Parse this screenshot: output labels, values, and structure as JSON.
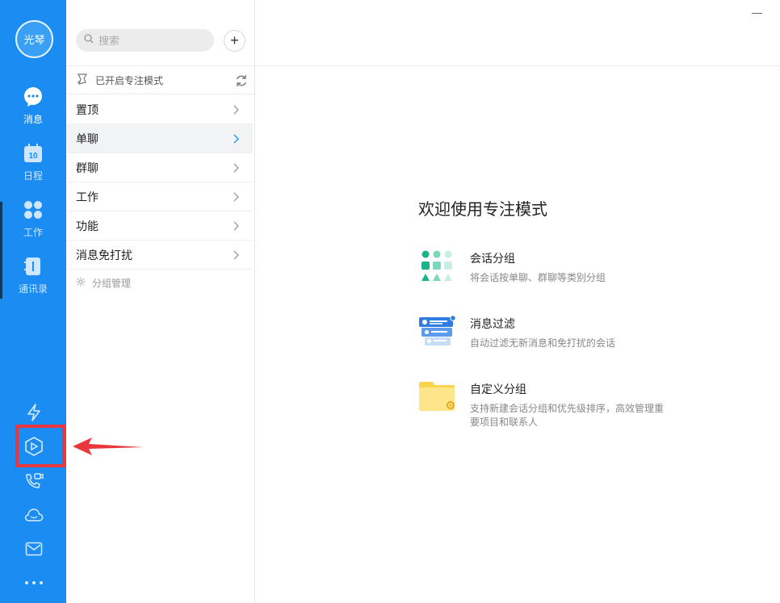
{
  "rail": {
    "avatar_text": "光琴",
    "nav": [
      {
        "label": "消息",
        "icon": "chat-icon",
        "active": true
      },
      {
        "label": "日程",
        "icon": "calendar-icon",
        "badge": "10"
      },
      {
        "label": "工作",
        "icon": "apps-grid-icon"
      },
      {
        "label": "通讯录",
        "icon": "contacts-book-icon"
      }
    ],
    "utilities": [
      "lightning-icon",
      "hexagon-app-icon",
      "phone-video-icon",
      "cloud-icon",
      "mail-icon",
      "more-dots-icon"
    ]
  },
  "middle": {
    "search_placeholder": "搜索",
    "add_label": "+",
    "focus_mode_label": "已开启专注模式",
    "groups": [
      {
        "label": "置顶"
      },
      {
        "label": "单聊",
        "selected": true
      },
      {
        "label": "群聊"
      },
      {
        "label": "工作"
      },
      {
        "label": "功能"
      },
      {
        "label": "消息免打扰"
      }
    ],
    "manage_label": "分组管理"
  },
  "content": {
    "welcome_title": "欢迎使用专注模式",
    "features": [
      {
        "title": "会话分组",
        "desc": "将会话按单聊、群聊等类别分组",
        "icon": "session-group-icon"
      },
      {
        "title": "消息过滤",
        "desc": "自动过滤无新消息和免打扰的会话",
        "icon": "message-filter-icon"
      },
      {
        "title": "自定义分组",
        "desc": "支持新建会话分组和优先级排序，高效管理重要项目和联系人",
        "icon": "custom-folder-icon"
      }
    ]
  },
  "colors": {
    "rail": "#1b8cf2",
    "accent": "#1b8cf2",
    "annotation": "#e8383d"
  }
}
